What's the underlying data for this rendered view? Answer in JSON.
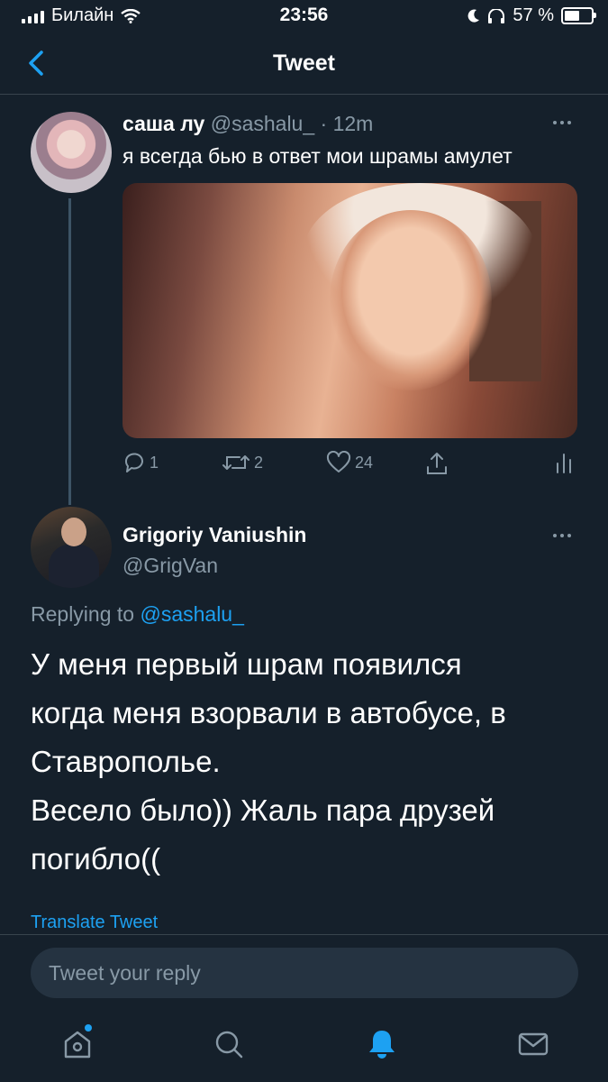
{
  "status_bar": {
    "carrier": "Билайн",
    "time": "23:56",
    "battery": "57 %",
    "battery_level": 0.57
  },
  "nav": {
    "title": "Tweet",
    "back_icon": "chevron-left-icon"
  },
  "original_tweet": {
    "name": "саша лу",
    "handle": "@sashalu_",
    "time": "· 12m",
    "text": "я всегда бью в ответ мои шрамы амулет",
    "actions": {
      "replies": "1",
      "retweets": "2",
      "likes": "24"
    }
  },
  "reply_tweet": {
    "name": "Grigoriy Vaniushin",
    "handle": "@GrigVan",
    "replying_prefix": "Replying to",
    "replying_handle": "@sashalu_",
    "body": "У меня первый шрам появился\nкогда  меня взорвали в автобусе, в\nСтаврополье.\nВесело было)) Жаль пара друзей\nпогибло((",
    "translate": "Translate Tweet"
  },
  "reply_bar": {
    "placeholder": "Tweet your reply"
  },
  "colors": {
    "background": "#15202b",
    "accent": "#1da1f2",
    "muted": "#8899a6",
    "divider": "#38444d"
  }
}
